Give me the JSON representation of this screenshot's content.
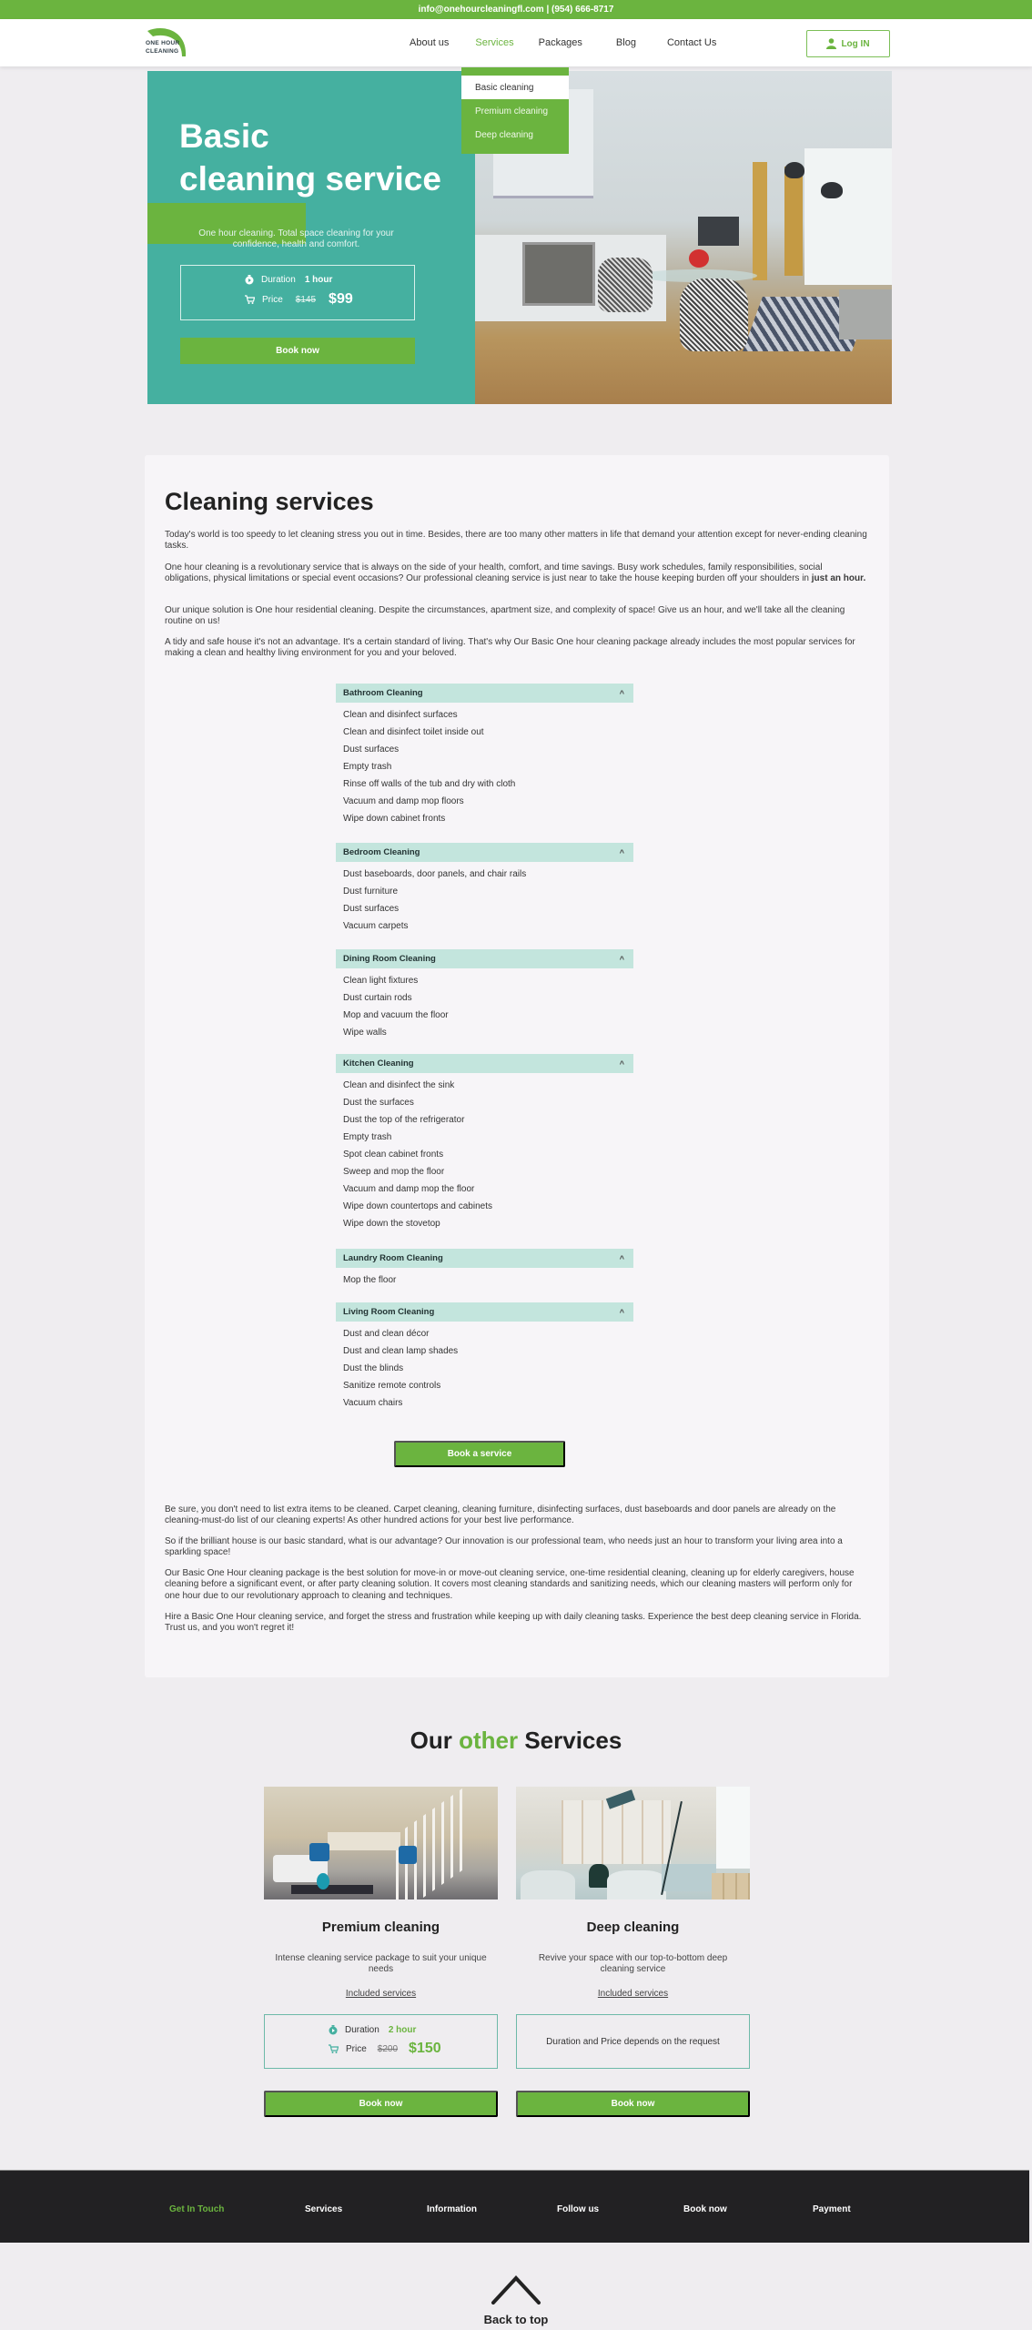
{
  "topbar": {
    "contact": "info@onehourcleaningfl.com | (954) 666-8717"
  },
  "header": {
    "logo": {
      "line1": "ONE HOUR",
      "line2": "CLEANING"
    },
    "nav": [
      {
        "label": "About us",
        "active": false
      },
      {
        "label": "Services",
        "active": true
      },
      {
        "label": "Packages",
        "active": false
      },
      {
        "label": "Blog",
        "active": false
      },
      {
        "label": "Contact Us",
        "active": false
      }
    ],
    "login_label": "Log IN",
    "services_dropdown": [
      {
        "label": "Basic cleaning",
        "selected": true
      },
      {
        "label": "Premium cleaning",
        "selected": false
      },
      {
        "label": "Deep cleaning",
        "selected": false
      }
    ]
  },
  "hero": {
    "title_line1": "Basic",
    "title_highlight": "cleaning",
    "title_rest": " service",
    "subtitle": "One hour cleaning. Total space cleaning for your confidence, health and comfort.",
    "duration_label": "Duration",
    "duration_value": "1 hour",
    "price_label": "Price",
    "old_price": "$145",
    "price": "$99",
    "book_label": "Book now"
  },
  "main": {
    "title": "Cleaning services",
    "intro_paragraphs": [
      "Today's world is too speedy to let cleaning stress you out in time. Besides, there are too many other matters in life that demand your attention except for never-ending cleaning tasks.",
      "One hour cleaning is a revolutionary service that is always on the side of your health, comfort, and time savings. Busy work schedules, family responsibilities, social obligations, physical limitations or special event occasions? Our professional cleaning service is just near to take the house keeping burden off your shoulders in ",
      "Our unique solution is One hour residential cleaning. Despite the circumstances, apartment size, and complexity of space! Give us an hour, and we'll take all the cleaning routine on us!",
      "A tidy and safe house it's not an advantage. It's a certain standard of living. That's why Our Basic One hour cleaning package already includes the most popular services for making a clean and healthy living environment for you and your beloved."
    ],
    "intro_bold_tail": "just an hour.",
    "accordion": [
      {
        "title": "Bathroom Cleaning",
        "items": [
          "Clean and disinfect surfaces",
          "Clean and disinfect toilet inside out",
          "Dust surfaces",
          "Empty trash",
          "Rinse off walls of the tub and dry with cloth",
          "Vacuum and damp mop floors",
          "Wipe down cabinet fronts"
        ]
      },
      {
        "title": "Bedroom Cleaning",
        "items": [
          "Dust baseboards, door panels, and chair rails",
          "Dust furniture",
          "Dust surfaces",
          "Vacuum carpets"
        ]
      },
      {
        "title": "Dining Room Cleaning",
        "items": [
          "Clean light fixtures",
          "Dust curtain rods",
          "Mop and vacuum the floor",
          "Wipe walls"
        ]
      },
      {
        "title": "Kitchen Cleaning",
        "items": [
          "Clean and disinfect the sink",
          "Dust the surfaces",
          "Dust the top of the refrigerator",
          "Empty trash",
          "Spot clean cabinet fronts",
          "Sweep and mop the floor",
          "Vacuum and damp mop the floor",
          "Wipe down countertops and cabinets",
          "Wipe down the stovetop"
        ]
      },
      {
        "title": "Laundry Room Cleaning",
        "items": [
          "Mop the floor"
        ]
      },
      {
        "title": "Living Room Cleaning",
        "items": [
          "Dust and clean décor",
          "Dust and clean lamp shades",
          "Dust the blinds",
          "Sanitize remote controls",
          "Vacuum chairs"
        ]
      }
    ],
    "book_service_label": "Book a service",
    "outro_paragraphs": [
      "Be sure, you don't need to list extra items to be cleaned. Carpet cleaning, cleaning furniture, disinfecting surfaces, dust baseboards and door panels are already on the cleaning-must-do list of our cleaning experts! As other hundred actions for your best live performance.",
      "So if the brilliant house is our basic standard, what is our advantage? Our innovation is our professional team, who needs just an hour to transform your living area into a sparkling space!",
      "Our Basic One Hour cleaning package is the best solution for move-in or move-out cleaning service, one-time residential cleaning, cleaning up for elderly caregivers, house cleaning before a significant event, or after party cleaning solution. It covers most cleaning standards and sanitizing needs, which our cleaning masters will perform only for one hour due to our revolutionary approach to cleaning and techniques.",
      "Hire a Basic One Hour cleaning service, and forget the stress and frustration while keeping up with daily cleaning tasks. Experience the best deep cleaning service in Florida. Trust us, and you won't regret it!"
    ]
  },
  "other_services": {
    "title_part1": "Our ",
    "title_highlight": "other",
    "title_part2": " Services",
    "cards": [
      {
        "name": "Premium cleaning",
        "description": "Intense cleaning service package to suit your unique needs",
        "included_label": "Included services",
        "duration_label": "Duration",
        "duration_value": "2 hour",
        "price_label": "Price",
        "old_price": "$200",
        "price": "$150",
        "book_label": "Book now"
      },
      {
        "name": "Deep cleaning",
        "description": "Revive your space with our top-to-bottom deep cleaning service",
        "included_label": "Included services",
        "note": "Duration and Price depends on the request",
        "book_label": "Book now"
      }
    ]
  },
  "footer": {
    "items": [
      "Get In Touch",
      "Services",
      "Information",
      "Follow us",
      "Book now",
      "Payment"
    ]
  },
  "back_to_top": {
    "label": "Back to top"
  },
  "colors": {
    "brand_green": "#6bb43f",
    "teal": "#45b0a0",
    "accordion_header": "#c3e5dd",
    "footer_bg": "#222123"
  }
}
